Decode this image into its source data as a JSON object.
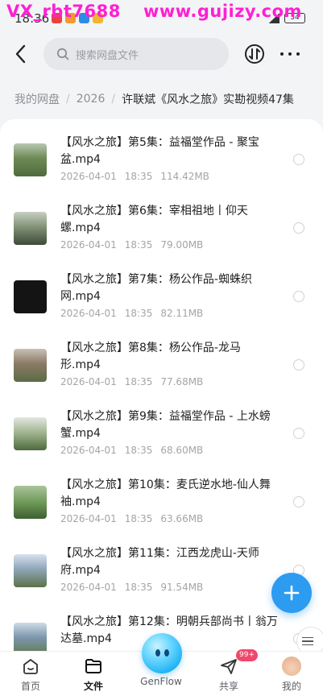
{
  "status_bar": {
    "time": "18:36",
    "battery": "34"
  },
  "watermark": {
    "left": "VX_rbt7688",
    "right": "www.gujizy.com"
  },
  "header": {
    "search_placeholder": "搜索网盘文件"
  },
  "breadcrumb": {
    "items": [
      "我的网盘",
      "2026"
    ],
    "current": "许联斌《风水之旅》实勘视频47集"
  },
  "files": [
    {
      "name": "【风水之旅】第5集：益福堂作品 - 聚宝盆.mp4",
      "date": "2026-04-01",
      "time": "18:35",
      "size": "114.42MB",
      "thumb_color": "#6d8a56"
    },
    {
      "name": "【风水之旅】第6集：宰相祖地丨仰天螺.mp4",
      "date": "2026-04-01",
      "time": "18:35",
      "size": "79.00MB",
      "thumb_color": "#7b8c70"
    },
    {
      "name": "【风水之旅】第7集：杨公作品-蜘蛛织网.mp4",
      "date": "2026-04-01",
      "time": "18:35",
      "size": "82.11MB",
      "thumb_color": "#141414"
    },
    {
      "name": "【风水之旅】第8集：杨公作品-龙马形.mp4",
      "date": "2026-04-01",
      "time": "18:35",
      "size": "77.68MB",
      "thumb_color": "#8a7a66"
    },
    {
      "name": "【风水之旅】第9集：益福堂作品 - 上水螃蟹.mp4",
      "date": "2026-04-01",
      "time": "18:35",
      "size": "68.60MB",
      "thumb_color": "#9bb08a"
    },
    {
      "name": "【风水之旅】第10集：麦氏逆水地-仙人舞袖.mp4",
      "date": "2026-04-01",
      "time": "18:35",
      "size": "63.66MB",
      "thumb_color": "#6f9a58"
    },
    {
      "name": "【风水之旅】第11集：江西龙虎山-天师府.mp4",
      "date": "2026-04-01",
      "time": "18:35",
      "size": "91.54MB",
      "thumb_color": "#8fa5b8"
    },
    {
      "name": "【风水之旅】第12集：明朝兵部尚书丨翁万达墓.mp4",
      "date": "",
      "time": "",
      "size": "",
      "thumb_color": "#7d96ad"
    }
  ],
  "tabs": [
    {
      "label": "首页",
      "icon": "home-icon"
    },
    {
      "label": "文件",
      "icon": "folder-icon"
    },
    {
      "label": "GenFlow",
      "icon": "genflow-mascot-icon"
    },
    {
      "label": "共享",
      "icon": "share-send-icon"
    },
    {
      "label": "我的",
      "icon": "avatar-icon"
    }
  ],
  "share_badge": "99+",
  "colors": {
    "accent": "#2d9bf0",
    "watermark": "#ff1fd2",
    "badge": "#f0476a"
  }
}
